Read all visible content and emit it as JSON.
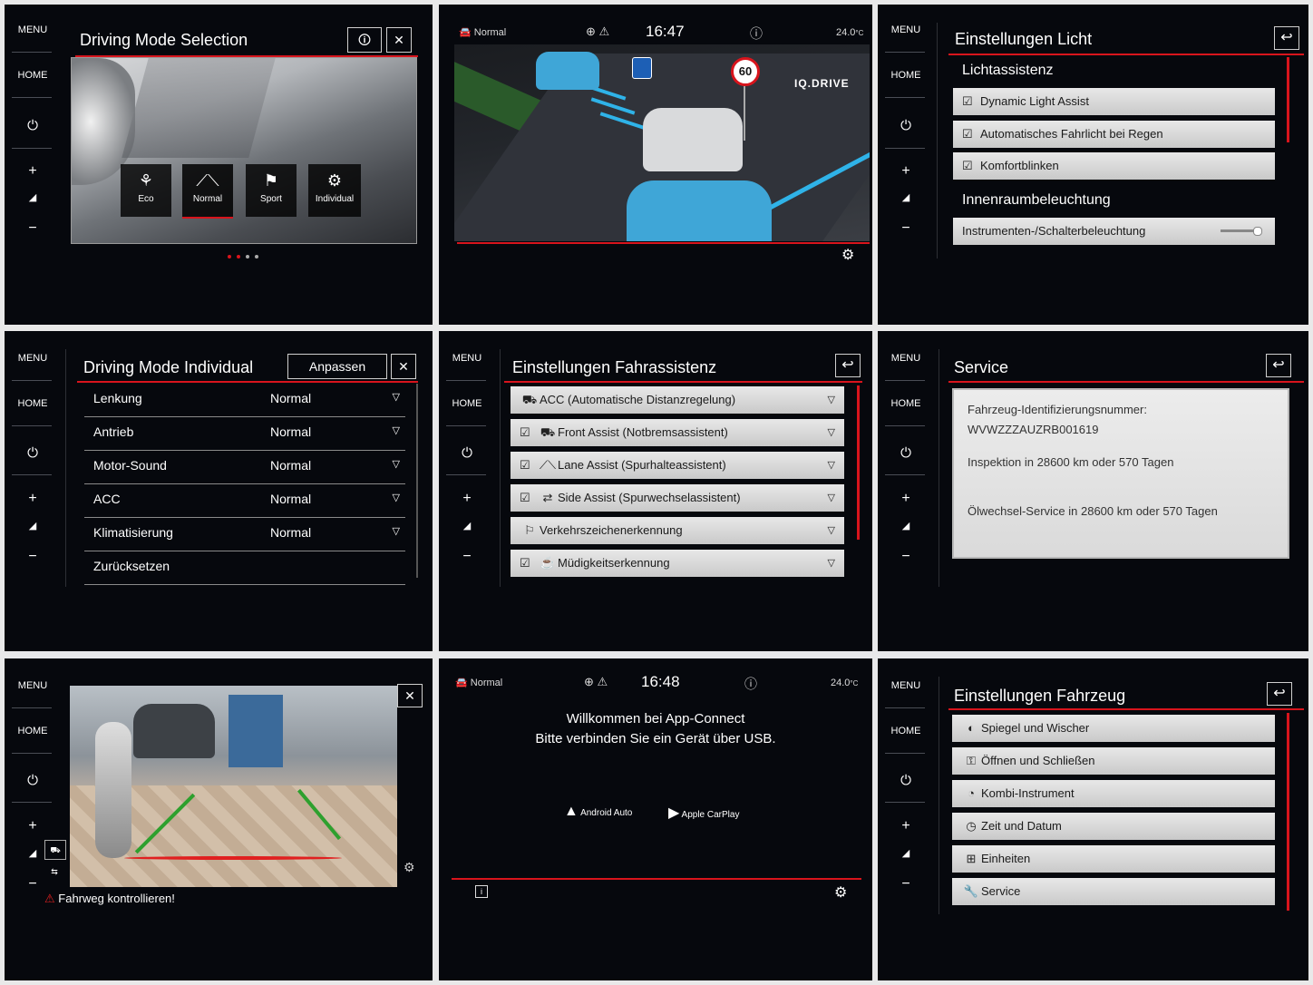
{
  "menu": {
    "menu": "MENU",
    "home": "HOME",
    "power": "⏻",
    "plus": "+",
    "vol": "◢",
    "minus": "−"
  },
  "p1": {
    "title": "Driving Mode Selection",
    "info": "🛈",
    "close": "✕",
    "modes": [
      {
        "label": "Eco",
        "icon": "⚘"
      },
      {
        "label": "Normal",
        "icon": "⟋⟍"
      },
      {
        "label": "Sport",
        "icon": "⚑"
      },
      {
        "label": "Individual",
        "icon": "⚙"
      }
    ]
  },
  "p2": {
    "mode": "Normal",
    "time": "16:47",
    "temp": "24.0",
    "temp_unit": "°C",
    "speed_sign": "60",
    "brand": "IQ.DRIVE",
    "gear": "⚙"
  },
  "p3": {
    "title": "Einstellungen Licht",
    "sec1": "Lichtassistenz",
    "items": [
      "Dynamic Light Assist",
      "Automatisches Fahrlicht bei Regen",
      "Komfortblinken"
    ],
    "sec2": "Innenraumbeleuchtung",
    "slider_label": "Instrumenten-/Schalterbeleuchtung",
    "slider_level": 0.8
  },
  "p4": {
    "title": "Driving Mode Individual",
    "button": "Anpassen",
    "close": "✕",
    "rows": [
      {
        "label": "Lenkung",
        "value": "Normal"
      },
      {
        "label": "Antrieb",
        "value": "Normal"
      },
      {
        "label": "Motor-Sound",
        "value": "Normal"
      },
      {
        "label": "ACC",
        "value": "Normal"
      },
      {
        "label": "Klimatisierung",
        "value": "Normal"
      },
      {
        "label": "Zurücksetzen",
        "value": ""
      }
    ]
  },
  "p5": {
    "title": "Einstellungen Fahrassistenz",
    "items": [
      {
        "label": "ACC (Automatische Distanzregelung)",
        "check": false
      },
      {
        "label": "Front Assist (Notbremsassistent)",
        "check": true
      },
      {
        "label": "Lane Assist (Spurhalteassistent)",
        "check": true
      },
      {
        "label": "Side Assist (Spurwechselassistent)",
        "check": true
      },
      {
        "label": "Verkehrszeichenerkennung",
        "check": false
      },
      {
        "label": "Müdigkeitserkennung",
        "check": true
      }
    ]
  },
  "p6": {
    "title": "Service",
    "vin_label": "Fahrzeug-Identifizierungsnummer:",
    "vin": "WVWZZZAUZRB001619",
    "inspection": "Inspektion in 28600 km oder 570 Tagen",
    "oil": "Ölwechsel-Service in 28600 km oder 570 Tagen"
  },
  "p7": {
    "warning": "Fahrweg kontrollieren!",
    "close": "✕"
  },
  "p8": {
    "mode": "Normal",
    "time": "16:48",
    "temp": "24.0",
    "temp_unit": "°C",
    "line1": "Willkommen bei App-Connect",
    "line2": "Bitte verbinden Sie ein Gerät über USB.",
    "android": "Android Auto",
    "carplay": "Apple CarPlay"
  },
  "p9": {
    "title": "Einstellungen Fahrzeug",
    "items": [
      "Spiegel und Wischer",
      "Öffnen und Schließen",
      "Kombi-Instrument",
      "Zeit und Datum",
      "Einheiten",
      "Service"
    ]
  },
  "colors": {
    "accent": "#d8141c",
    "bg": "#06080d",
    "item": "#d4d4d4"
  }
}
